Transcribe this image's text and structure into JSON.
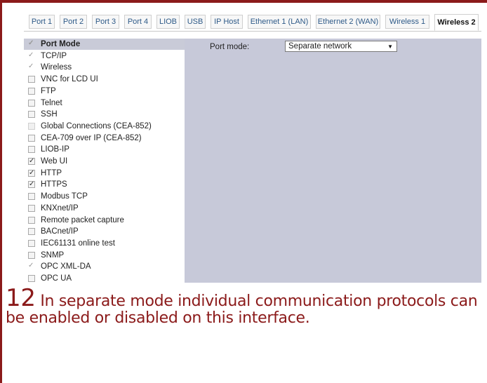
{
  "tabs": [
    {
      "label": "Port 1"
    },
    {
      "label": "Port 2"
    },
    {
      "label": "Port 3"
    },
    {
      "label": "Port 4"
    },
    {
      "label": "LIOB"
    },
    {
      "label": "USB"
    },
    {
      "label": "IP Host"
    },
    {
      "label": "Ethernet 1 (LAN)"
    },
    {
      "label": "Ethernet 2 (WAN)"
    },
    {
      "label": "Wireless 1"
    },
    {
      "label": "Wireless 2"
    }
  ],
  "active_tab": "Wireless 2",
  "protocols": [
    {
      "label": "Port Mode",
      "checked": true,
      "disabled": true,
      "header": true
    },
    {
      "label": "TCP/IP",
      "checked": true,
      "disabled": true
    },
    {
      "label": "Wireless",
      "checked": true,
      "disabled": true
    },
    {
      "label": "VNC for LCD UI",
      "checked": false,
      "disabled": false
    },
    {
      "label": "FTP",
      "checked": false,
      "disabled": false
    },
    {
      "label": "Telnet",
      "checked": false,
      "disabled": false
    },
    {
      "label": "SSH",
      "checked": false,
      "disabled": false
    },
    {
      "label": "Global Connections (CEA-852)",
      "checked": false,
      "disabled": true
    },
    {
      "label": "CEA-709 over IP (CEA-852)",
      "checked": false,
      "disabled": false
    },
    {
      "label": "LIOB-IP",
      "checked": false,
      "disabled": false
    },
    {
      "label": "Web UI",
      "checked": true,
      "disabled": false
    },
    {
      "label": "HTTP",
      "checked": true,
      "disabled": false
    },
    {
      "label": "HTTPS",
      "checked": true,
      "disabled": false
    },
    {
      "label": "Modbus TCP",
      "checked": false,
      "disabled": false
    },
    {
      "label": "KNXnet/IP",
      "checked": false,
      "disabled": false
    },
    {
      "label": "Remote packet capture",
      "checked": false,
      "disabled": false
    },
    {
      "label": "BACnet/IP",
      "checked": false,
      "disabled": false
    },
    {
      "label": "IEC61131 online test",
      "checked": false,
      "disabled": false
    },
    {
      "label": "SNMP",
      "checked": false,
      "disabled": false
    },
    {
      "label": "OPC XML-DA",
      "checked": true,
      "disabled": true
    },
    {
      "label": "OPC UA",
      "checked": false,
      "disabled": false
    }
  ],
  "port_mode": {
    "label": "Port mode:",
    "value": "Separate network"
  },
  "caption": {
    "number": "12",
    "text": " In separate mode individual communication protocols can be enabled or disabled on this interface."
  },
  "colors": {
    "accent": "#8b1a1a",
    "panel": "#c7c9d9"
  }
}
